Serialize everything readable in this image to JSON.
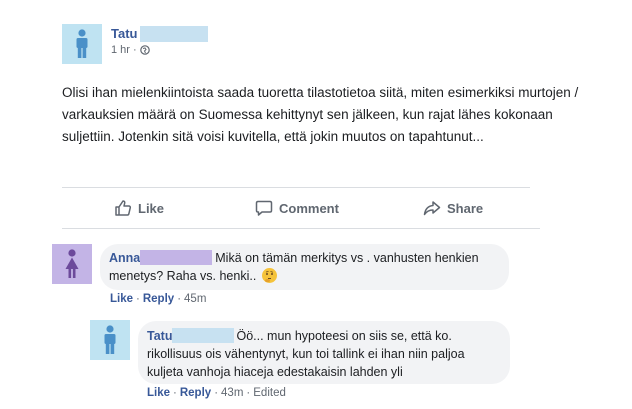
{
  "post": {
    "author": "Tatu",
    "time": "1 hr",
    "separator": "·",
    "privacy_icon": "globe-icon",
    "text": "Olisi ihan mielenkiintoista saada tuoretta tilastotietoa siitä, miten esimerkiksi murtojen / varkauksien määrä on Suomessa kehittynyt sen jälkeen, kun rajat lähes kokonaan suljettiin. Jotenkin sitä voisi kuvitella, että jokin muutos on tapahtunut..."
  },
  "actions": {
    "like": "Like",
    "comment": "Comment",
    "share": "Share"
  },
  "comments": [
    {
      "author": "Anna",
      "text": "Mikä on tämän merkitys vs . vanhusten henkien menetys? Raha vs. henki..",
      "emoji": "thinking-face",
      "like": "Like",
      "reply": "Reply",
      "time": "45m",
      "edited": ""
    },
    {
      "author": "Tatu",
      "text": "Öö... mun hypoteesi on siis se, että ko. rikollisuus ois vähentynyt, kun toi tallink ei ihan niin paljoa kuljeta vanhoja hiaceja edestakaisin lahden yli",
      "like": "Like",
      "reply": "Reply",
      "time": "43m",
      "edited": "Edited"
    }
  ],
  "colors": {
    "link": "#385898",
    "meta": "#606770",
    "bubble": "#f2f3f5",
    "male_avatar_bg": "#bfe3f2",
    "female_avatar_bg": "#c3b4e6"
  }
}
